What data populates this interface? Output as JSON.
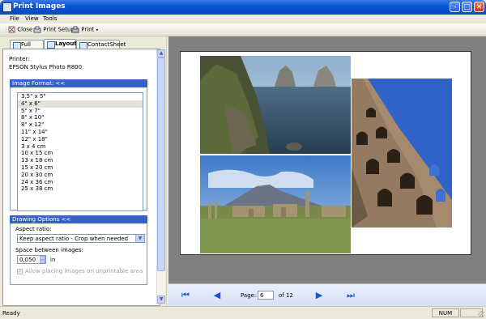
{
  "window": {
    "title": "Print Images"
  },
  "menu": [
    "File",
    "View",
    "Tools"
  ],
  "toolbar": {
    "close_label": "Close",
    "print_setup_label": "Print Setup",
    "print_label": "Print"
  },
  "tabs": [
    "Full Page",
    "Layout",
    "ContactSheet"
  ],
  "printer": {
    "label": "Printer:",
    "name": "EPSON Stylus Photo R800"
  },
  "image_format": {
    "header": "Image Format: <<",
    "selected_index": 1,
    "options": [
      "3,5\" x 5\"",
      "4\" x 6\"",
      "5\" x 7\"",
      "8\" x 10\"",
      "8\" x 12\"",
      "11\" x 14\"",
      "12\" x 18\"",
      "3 x 4 cm",
      "10 x 15 cm",
      "13 x 18 cm",
      "15 x 20 cm",
      "20 x 30 cm",
      "24 x 36 cm",
      "25 x 38 cm"
    ]
  },
  "drawing_options": {
    "header": "Drawing Options <<",
    "aspect_ratio_label": "Aspect ratio:",
    "aspect_ratio_value": "Keep aspect ratio - Crop when needed",
    "space_label": "Space between images:",
    "space_value": "0,050",
    "space_unit": "in",
    "allow_unprintable_label": "Allow placing images on unprintable area",
    "allow_unprintable_checked": true
  },
  "navigation": {
    "page_label": "Page:",
    "page_value": "6",
    "of_label": "of 12"
  },
  "status": {
    "text": "Ready",
    "num": "NUM"
  }
}
